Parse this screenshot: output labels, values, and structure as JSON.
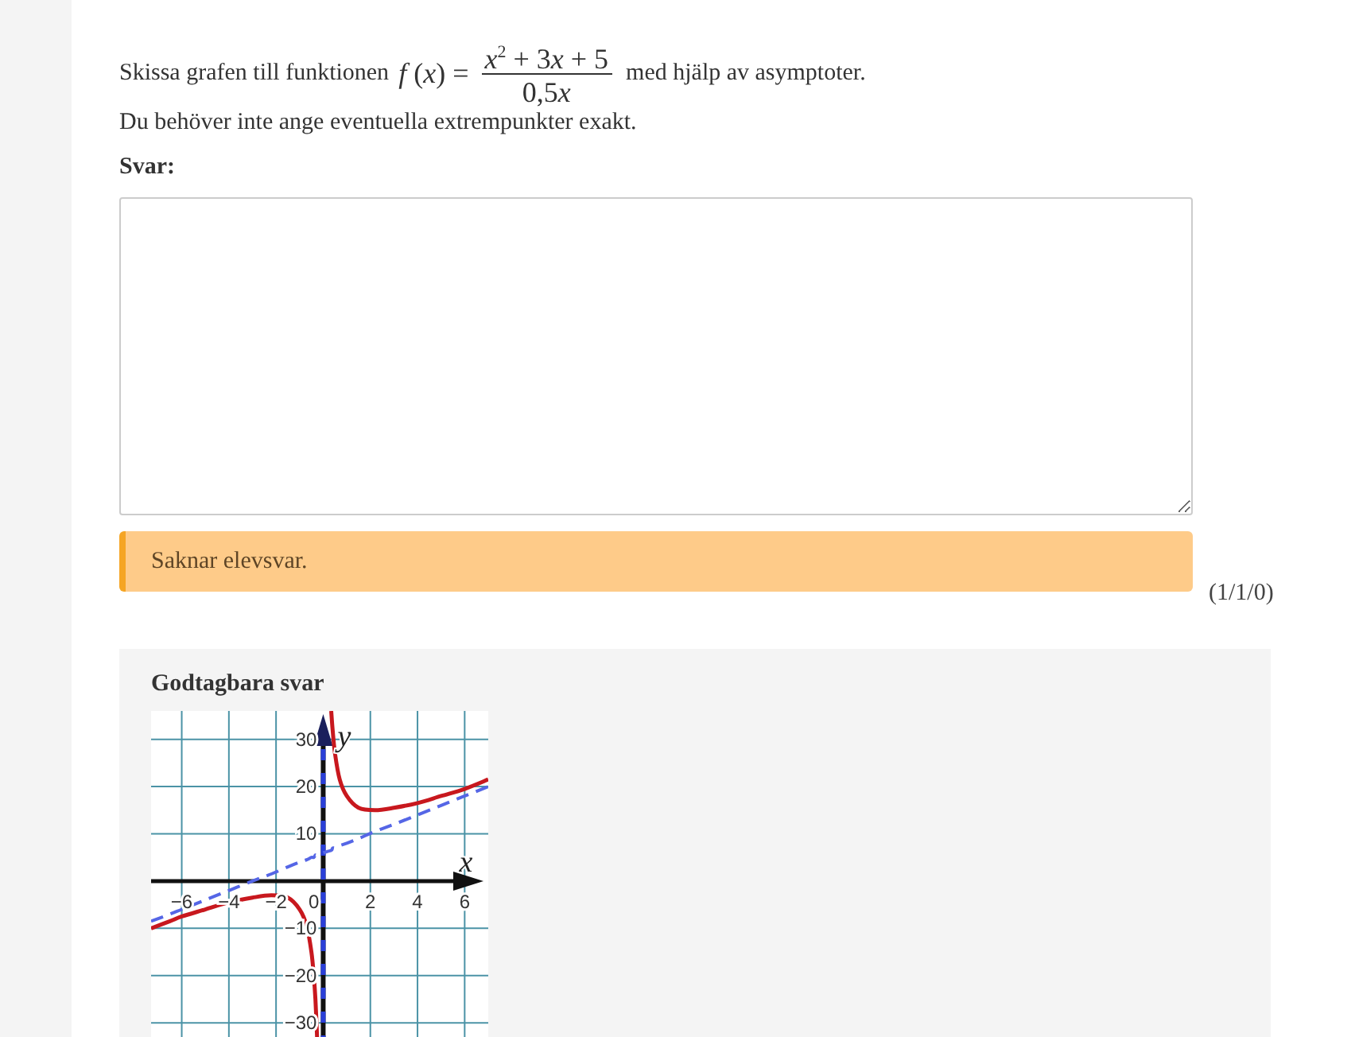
{
  "question": {
    "text_before": "Skissa grafen till funktionen",
    "formula": {
      "lhs": [
        {
          "kind": "var",
          "text": "f"
        },
        {
          "kind": "text",
          "text": " ("
        },
        {
          "kind": "var",
          "text": "x"
        },
        {
          "kind": "text",
          "text": ") ="
        }
      ],
      "numerator": [
        {
          "kind": "var",
          "text": "x"
        },
        {
          "kind": "sup",
          "text": "2"
        },
        {
          "kind": "text",
          "text": " + 3"
        },
        {
          "kind": "var",
          "text": "x"
        },
        {
          "kind": "text",
          "text": " + 5"
        }
      ],
      "denominator": [
        {
          "kind": "text",
          "text": "0,5"
        },
        {
          "kind": "var",
          "text": "x"
        }
      ]
    },
    "text_after": "med hjälp av asymptoter.",
    "hint": "Du behöver inte ange eventuella extrempunkter exakt."
  },
  "answer": {
    "label": "Svar:"
  },
  "feedback": {
    "message": "Saknar elevsvar.",
    "score": "(1/1/0)"
  },
  "solution": {
    "title": "Godtagbara svar",
    "chart_data": {
      "type": "line",
      "xlabel": "x",
      "ylabel": "y",
      "x": [
        -7.3,
        -6.5,
        -6,
        -5,
        -4,
        -3,
        -2.2,
        -1.5,
        -1,
        -0.7,
        -0.5,
        -0.4,
        -0.33,
        -0.26,
        0,
        0.34,
        0.4,
        0.5,
        0.7,
        1,
        1.5,
        2.2,
        3,
        4,
        5,
        6,
        7
      ],
      "series": [
        {
          "color": "#c8181e",
          "values": [
            -10,
            -8.5,
            -7.5,
            -6,
            -4.5,
            -3.5,
            -3,
            -3.5,
            -6,
            -9.5,
            -15,
            -20,
            -25,
            -33,
            null,
            36,
            32,
            27,
            21.5,
            18,
            15.5,
            15,
            15.5,
            16.5,
            18,
            19.5,
            21.5
          ]
        },
        {
          "color": "#5566e6",
          "line_style": "dashed",
          "values": [
            -8.5,
            -7,
            -6,
            -4,
            -2,
            0,
            1.5,
            3,
            4,
            4.5,
            5,
            5,
            5.5,
            5.5,
            6,
            6.5,
            7,
            7,
            7.5,
            8,
            9,
            10.5,
            12,
            14,
            16,
            18,
            20
          ]
        }
      ],
      "xlim": [
        -7.3,
        7
      ],
      "ylim": [
        -33,
        36
      ],
      "xticks": [
        {
          "value": -6,
          "label": "−6"
        },
        {
          "value": -4,
          "label": "−4"
        },
        {
          "value": -2,
          "label": "−2"
        },
        0,
        2,
        4,
        6
      ],
      "yticks": [
        {
          "value": -30,
          "label": "−30"
        },
        {
          "value": -20,
          "label": "−20"
        },
        {
          "value": -10,
          "label": "−10"
        },
        10,
        20,
        30
      ],
      "grid": true,
      "ref_lines": [
        {
          "axis": "x",
          "value": 0,
          "color": "#2a3fd8",
          "line_style": "dashed"
        }
      ]
    }
  }
}
